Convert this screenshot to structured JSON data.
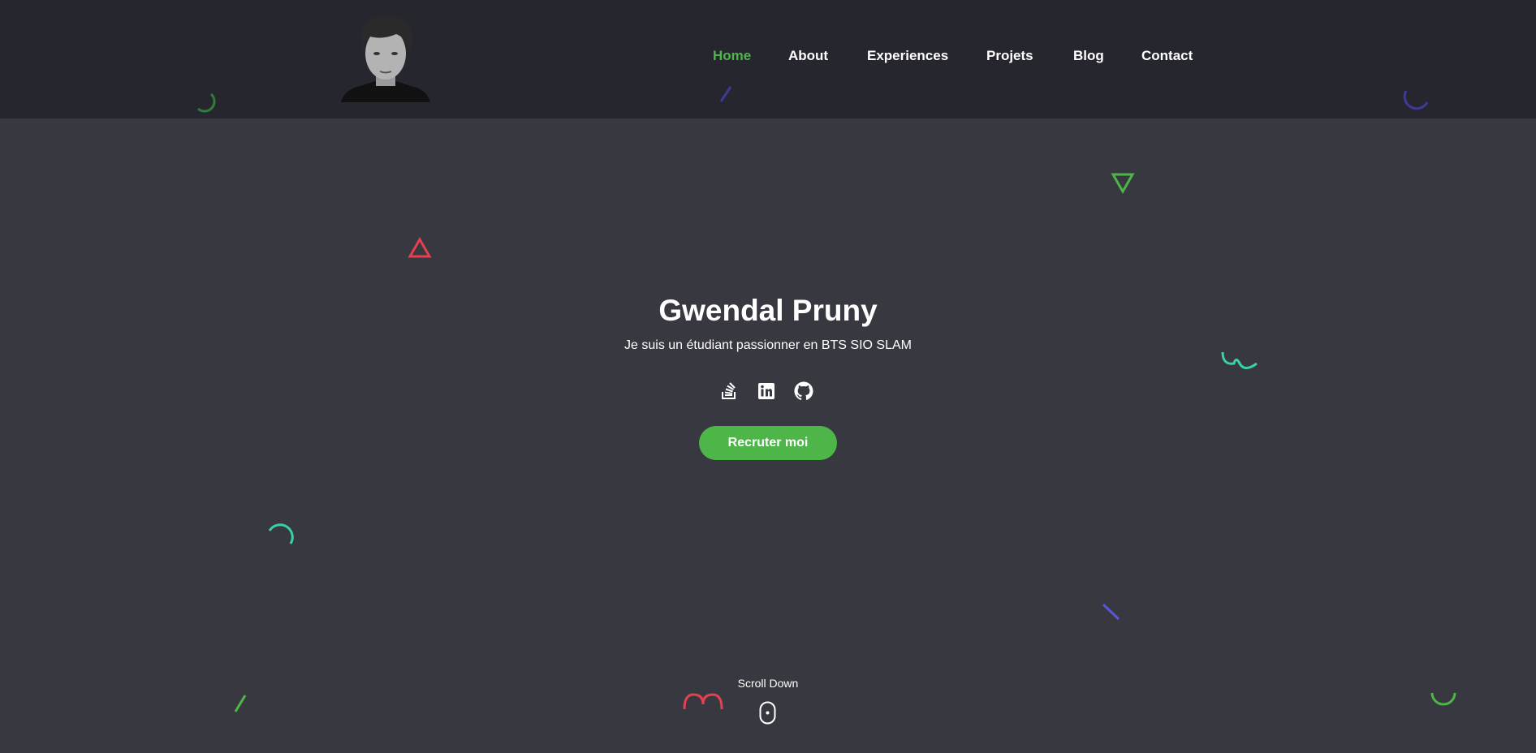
{
  "header": {
    "avatar_alt": "Gwendal Pruny",
    "nav": [
      {
        "label": "Home",
        "active": true
      },
      {
        "label": "About",
        "active": false
      },
      {
        "label": "Experiences",
        "active": false
      },
      {
        "label": "Projets",
        "active": false
      },
      {
        "label": "Blog",
        "active": false
      },
      {
        "label": "Contact",
        "active": false
      }
    ]
  },
  "hero": {
    "name": "Gwendal Pruny",
    "tagline": "Je suis un étudiant passionner en BTS SIO SLAM",
    "socials": [
      "stackoverflow-icon",
      "linkedin-icon",
      "github-icon"
    ],
    "cta_label": "Recruter moi",
    "scroll_label": "Scroll Down"
  },
  "colors": {
    "accent": "#4eb648",
    "header_bg": "#26262f",
    "page_bg": "#383841",
    "shape_red": "#e4404f",
    "shape_teal": "#3ad0a8",
    "shape_purple": "#5b56d6"
  }
}
